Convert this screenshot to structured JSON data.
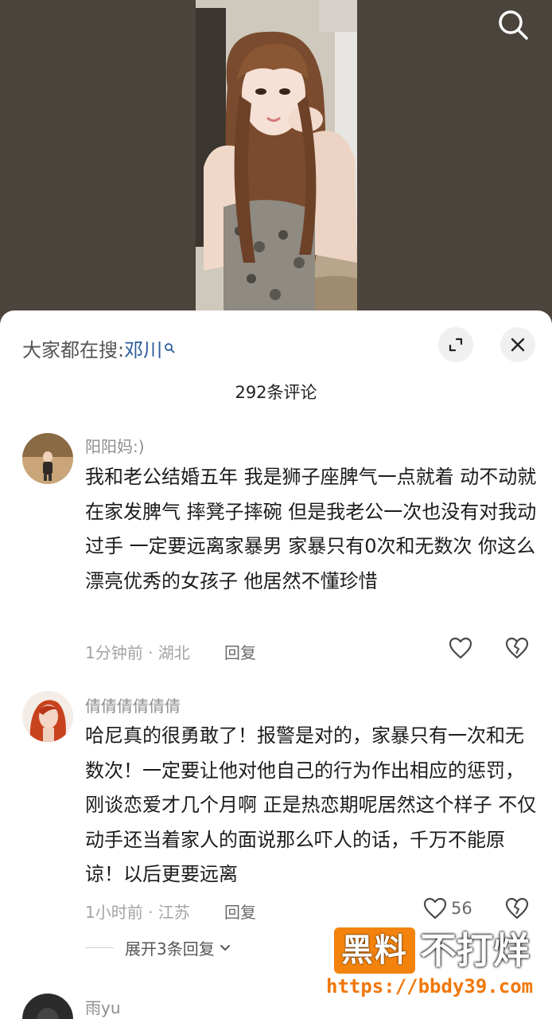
{
  "search_icon": "search-icon",
  "sheet": {
    "suggest_prefix": "大家都在搜:",
    "suggest_keyword": "邓川",
    "comment_count": "292条评论"
  },
  "comments": [
    {
      "user": "阳阳妈:)",
      "text": "我和老公结婚五年 我是狮子座脾气一点就着 动不动就在家发脾气 摔凳子摔碗 但是我老公一次也没有对我动过手 一定要远离家暴男 家暴只有0次和无数次 你这么漂亮优秀的女孩子 他居然不懂珍惜",
      "meta": "1分钟前 · 湖北",
      "reply": "回复",
      "likes": ""
    },
    {
      "user": "倩倩倩倩倩倩",
      "text": "哈尼真的很勇敢了！报警是对的，家暴只有一次和无数次！一定要让他对他自己的行为作出相应的惩罚，刚谈恋爱才几个月啊 正是热恋期呢居然这个样子 不仅动手还当着家人的面说那么吓人的话，千万不能原谅！以后更要远离",
      "meta": "1小时前 · 江苏",
      "reply": "回复",
      "likes": "56"
    },
    {
      "user": "雨yu"
    }
  ],
  "expand_replies": "展开3条回复",
  "watermark": {
    "brand": "黑料",
    "suffix": "不打烊",
    "url": "https://bbdy39.com"
  },
  "colors": {
    "keyword": "#2a5a9a",
    "watermark_orange": "#f3830c"
  }
}
